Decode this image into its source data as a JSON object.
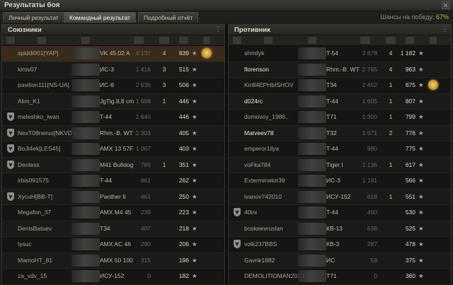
{
  "window": {
    "title": "Результаты боя",
    "close": "✕"
  },
  "tabs": [
    {
      "label": "Личный результат",
      "active": false
    },
    {
      "label": "Командный результат",
      "active": true
    },
    {
      "label": "Подробный отчёт",
      "active": false
    }
  ],
  "chance": {
    "label": "Шансы на победу:",
    "value": "67%"
  },
  "allies": {
    "title": "Союзники",
    "rows": [
      {
        "name": "spiddi001[YAP]",
        "tank": "VK 45.02 A",
        "dmg": "4 137",
        "kills": "4",
        "xp": "839",
        "squad": false,
        "medal": true,
        "me": true
      },
      {
        "name": "kirov07",
        "tank": "ИС-3",
        "dmg": "1 416",
        "kills": "3",
        "xp": "515",
        "squad": false
      },
      {
        "name": "pavilion111[NS-UA]",
        "tank": "ИС-8",
        "dmg": "2 635",
        "kills": "3",
        "xp": "506",
        "squad": false
      },
      {
        "name": "Alim_K1",
        "tank": "JgTig.8,8 cm",
        "dmg": "1 698",
        "kills": "1",
        "xp": "446",
        "squad": false
      },
      {
        "name": "meleshko_iwan",
        "tank": "T-44",
        "dmg": "1 640",
        "kills": "",
        "xp": "446",
        "squad": true
      },
      {
        "name": "NexT09nerus[NKVD-]",
        "tank": "Rhm.-B. WT",
        "dmg": "2 303",
        "kills": "",
        "xp": "405",
        "squad": true
      },
      {
        "name": "BoJl4ek[LES45]",
        "tank": "AMX 13 57F",
        "dmg": "1 067",
        "kills": "",
        "xp": "403",
        "squad": true
      },
      {
        "name": "Denless",
        "tank": "M41 Bulldog",
        "dmg": "789",
        "kills": "1",
        "xp": "351",
        "squad": true
      },
      {
        "name": "irbis091575",
        "tank": "T-44",
        "dmg": "861",
        "kills": "",
        "xp": "262",
        "squad": false
      },
      {
        "name": "XycuH[BB-T]",
        "tank": "Panther II",
        "dmg": "461",
        "kills": "",
        "xp": "250",
        "squad": true
      },
      {
        "name": "Megafon_37",
        "tank": "AMX M4 45",
        "dmg": "239",
        "kills": "",
        "xp": "223",
        "squad": false
      },
      {
        "name": "DenisBatuev",
        "tank": "T34",
        "dmg": "407",
        "kills": "",
        "xp": "218",
        "squad": false
      },
      {
        "name": "tysuc",
        "tank": "AMX AC 46",
        "dmg": "290",
        "kills": "",
        "xp": "206",
        "squad": false
      },
      {
        "name": "MamoHT_81",
        "tank": "AMX 50 100",
        "dmg": "315",
        "kills": "",
        "xp": "196",
        "squad": false
      },
      {
        "name": "za_vdv_15",
        "tank": "ИСУ-152",
        "dmg": "0",
        "kills": "",
        "xp": "182",
        "squad": false
      }
    ]
  },
  "enemies": {
    "title": "Противник",
    "rows": [
      {
        "name": "shmilyk",
        "tank": "T-54",
        "dmg": "3 878",
        "kills": "4",
        "xp": "1 182",
        "squad": false
      },
      {
        "name": "florenson",
        "tank": "Rhm.-B. WT",
        "dmg": "2 765",
        "kills": "4",
        "xp": "963",
        "squad": false,
        "bright": true
      },
      {
        "name": "Kirill4EPHbISHOV",
        "tank": "T34",
        "dmg": "2 452",
        "kills": "1",
        "xp": "875",
        "squad": false,
        "medal": true
      },
      {
        "name": "d024rc",
        "tank": "T-44",
        "dmg": "1 605",
        "kills": "1",
        "xp": "807",
        "squad": false,
        "bright": true
      },
      {
        "name": "domovoy_1986..",
        "tank": "T71",
        "dmg": "1 300",
        "kills": "1",
        "xp": "799",
        "squad": false
      },
      {
        "name": "Matveev78",
        "tank": "T32",
        "dmg": "1 571",
        "kills": "2",
        "xp": "776",
        "squad": false,
        "bright": true
      },
      {
        "name": "emperor1ilya",
        "tank": "T-44",
        "dmg": "980",
        "kills": "",
        "xp": "775",
        "squad": false
      },
      {
        "name": "voFka784",
        "tank": "Tiger I",
        "dmg": "1 136",
        "kills": "1",
        "xp": "617",
        "squad": false
      },
      {
        "name": "Exterminator39",
        "tank": "ИС-3",
        "dmg": "1 191",
        "kills": "",
        "xp": "566",
        "squad": false
      },
      {
        "name": "ivanov742010",
        "tank": "ИСУ-152",
        "dmg": "618",
        "kills": "1",
        "xp": "551",
        "squad": false
      },
      {
        "name": "40ini",
        "tank": "T-44",
        "dmg": "490",
        "kills": "",
        "xp": "530",
        "squad": true
      },
      {
        "name": "boskeevruslan",
        "tank": "КВ-13",
        "dmg": "638",
        "kills": "",
        "xp": "525",
        "squad": false
      },
      {
        "name": "volk237BBS",
        "tank": "КВ-3",
        "dmg": "287",
        "kills": "",
        "xp": "478",
        "squad": true
      },
      {
        "name": "Gavrik1882",
        "tank": "ИС",
        "dmg": "59",
        "kills": "",
        "xp": "375",
        "squad": false
      },
      {
        "name": "DEMOLITIOMAN2013",
        "tank": "T71",
        "dmg": "0",
        "kills": "",
        "xp": "360",
        "squad": false
      }
    ]
  },
  "icons": {
    "star": "★",
    "squad": "squad-icon",
    "medal": "medal-icon"
  }
}
